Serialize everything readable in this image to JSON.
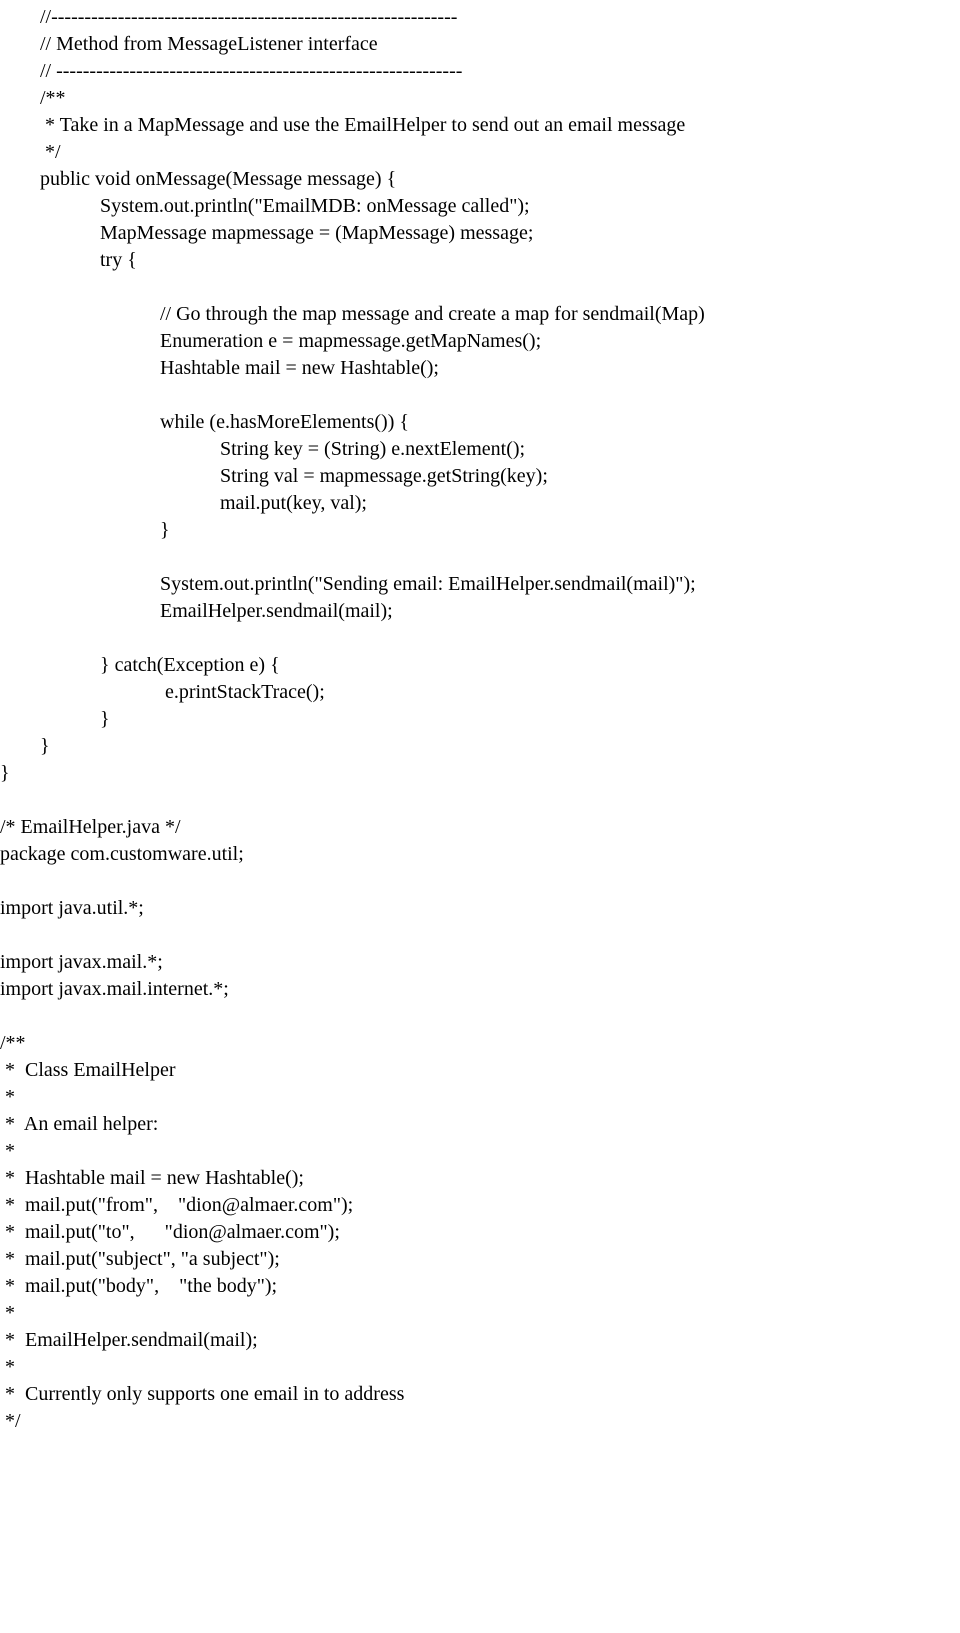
{
  "code": "        //-------------------------------------------------------------\n        // Method from MessageListener interface\n        // -------------------------------------------------------------\n        /**\n         * Take in a MapMessage and use the EmailHelper to send out an email message\n         */\n        public void onMessage(Message message) {\n                    System.out.println(\"EmailMDB: onMessage called\");\n                    MapMessage mapmessage = (MapMessage) message;\n                    try {\n\n                                // Go through the map message and create a map for sendmail(Map)\n                                Enumeration e = mapmessage.getMapNames();\n                                Hashtable mail = new Hashtable();\n\n                                while (e.hasMoreElements()) {\n                                            String key = (String) e.nextElement();\n                                            String val = mapmessage.getString(key);\n                                            mail.put(key, val);\n                                }\n\n                                System.out.println(\"Sending email: EmailHelper.sendmail(mail)\");\n                                EmailHelper.sendmail(mail);\n\n                    } catch(Exception e) {\n                                 e.printStackTrace();\n                    }\n        }\n}\n\n/* EmailHelper.java */\npackage com.customware.util;\n\nimport java.util.*;\n\nimport javax.mail.*;\nimport javax.mail.internet.*;\n\n/**\n *  Class EmailHelper\n *\n *  An email helper:\n *\n *  Hashtable mail = new Hashtable();\n *  mail.put(\"from\",    \"dion@almaer.com\");\n *  mail.put(\"to\",      \"dion@almaer.com\");\n *  mail.put(\"subject\", \"a subject\");\n *  mail.put(\"body\",    \"the body\");\n *\n *  EmailHelper.sendmail(mail);\n *\n *  Currently only supports one email in to address\n */"
}
